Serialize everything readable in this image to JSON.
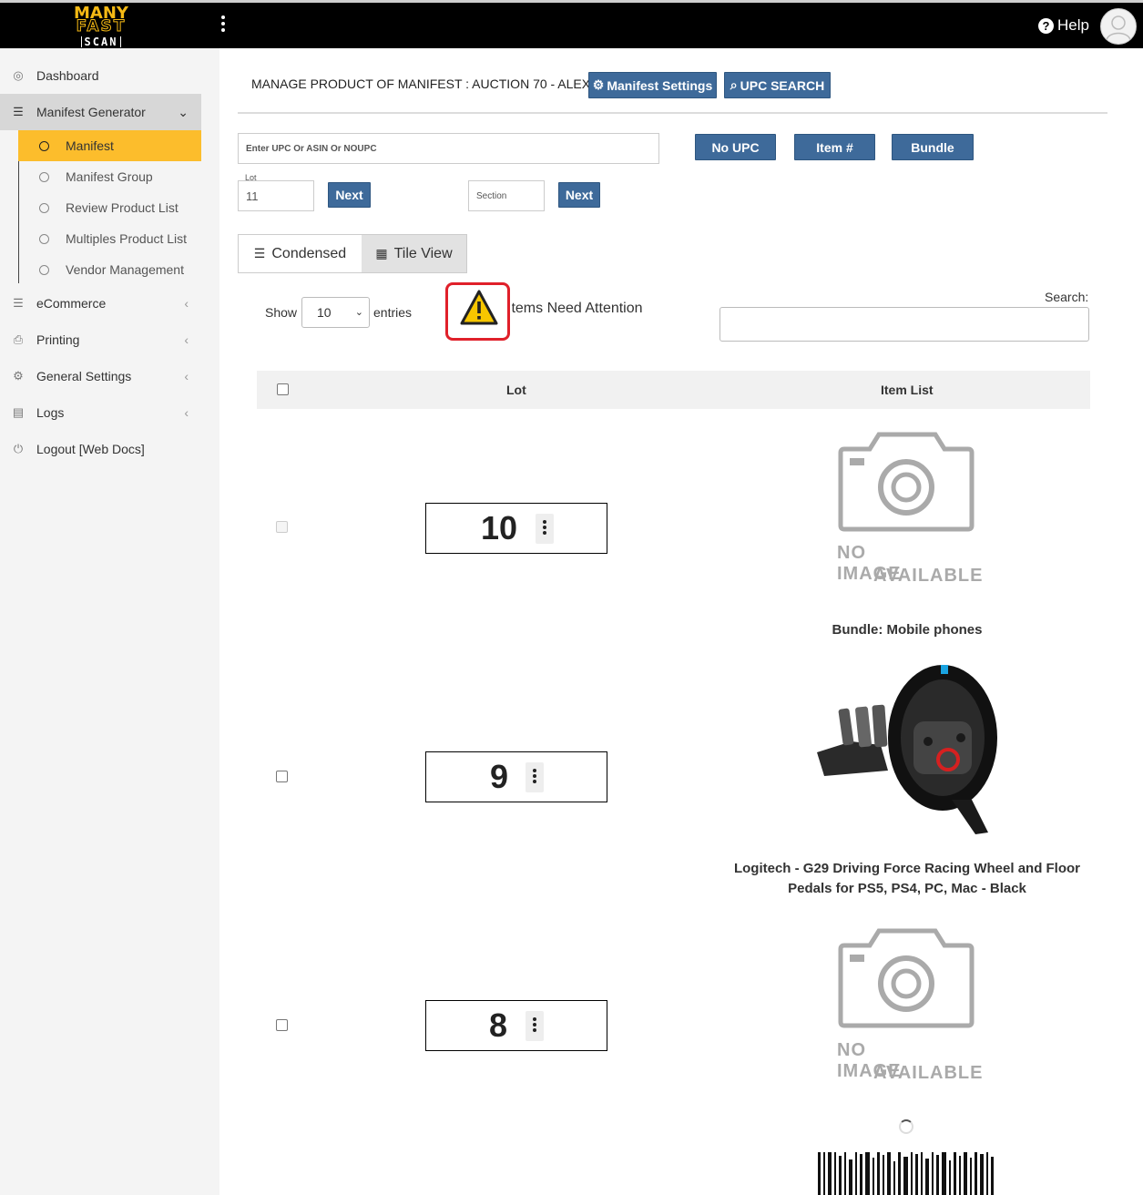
{
  "header": {
    "logo": {
      "line1": "MANY",
      "line2": "FAST",
      "line3": "SCAN"
    },
    "help_label": "Help",
    "menu_icon": "kebab-menu-icon",
    "avatar_icon": "user-avatar-icon"
  },
  "sidebar": {
    "items": [
      {
        "label": "Dashboard",
        "icon": "dashboard-icon"
      },
      {
        "label": "Manifest Generator",
        "icon": "list-icon",
        "expanded": true
      },
      {
        "label": "eCommerce",
        "icon": "list-icon"
      },
      {
        "label": "Printing",
        "icon": "printer-icon"
      },
      {
        "label": "General Settings",
        "icon": "gears-icon"
      },
      {
        "label": "Logs",
        "icon": "archive-icon"
      },
      {
        "label": "Logout [Web Docs]",
        "icon": "power-icon"
      }
    ],
    "subitems": [
      {
        "label": "Manifest",
        "active": true
      },
      {
        "label": "Manifest Group"
      },
      {
        "label": "Review Product List"
      },
      {
        "label": "Multiples Product List"
      },
      {
        "label": "Vendor Management"
      }
    ]
  },
  "page": {
    "title": "MANAGE PRODUCT OF MANIFEST : AUCTION 70 - ALEX",
    "manifest_settings": "Manifest Settings",
    "upc_search": "UPC SEARCH",
    "upc_placeholder": "Enter UPC Or ASIN Or NOUPC",
    "no_upc": "No UPC",
    "item_num": "Item #",
    "bundle": "Bundle",
    "lot_label": "Lot",
    "lot_value": "11",
    "next_label": "Next",
    "section_placeholder": "Section",
    "tab_condensed": "Condensed",
    "tab_tile": "Tile View",
    "show_label": "Show",
    "entries_value": "10",
    "entries_label": "entries",
    "attention_label": "Items Need Attention",
    "search_label": "Search:"
  },
  "table": {
    "columns": [
      "Lot",
      "Item List"
    ],
    "no_image": [
      "NO IMAGE",
      "AVAILABLE"
    ],
    "rows": [
      {
        "lot": "10",
        "item": "",
        "image": "no-image"
      },
      {
        "lot": "9",
        "item": "Logitech - G29 Driving Force Racing Wheel and Floor Pedals for PS5, PS4, PC, Mac - Black",
        "image": "racing-wheel"
      },
      {
        "lot": "8",
        "item": "",
        "image": "no-image"
      }
    ],
    "bundle_caption": "Bundle: Mobile phones"
  },
  "colors": {
    "accent": "#fcbd2c",
    "button": "#3e6a9a",
    "warning": "#e0202a"
  }
}
